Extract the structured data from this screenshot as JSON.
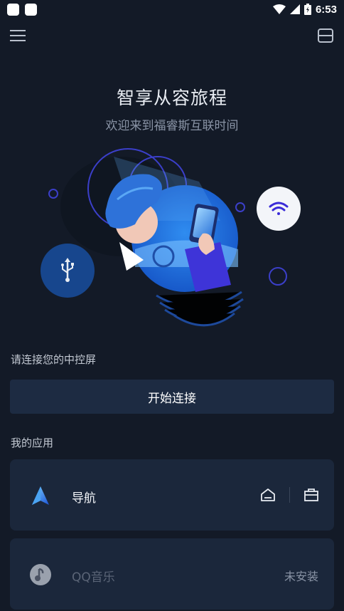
{
  "status_bar": {
    "time": "6:53"
  },
  "hero": {
    "title": "智享从容旅程",
    "subtitle": "欢迎来到福睿斯互联时间"
  },
  "connect": {
    "label": "请连接您的中控屏",
    "button": "开始连接"
  },
  "apps": {
    "label": "我的应用",
    "items": [
      {
        "name": "导航",
        "icon": "navigation-arrow-icon",
        "actions": [
          "home-icon",
          "briefcase-icon"
        ]
      },
      {
        "name": "QQ音乐",
        "icon": "qq-music-icon",
        "status": "未安装"
      }
    ]
  },
  "icons": {
    "menu": "menu-icon",
    "device": "device-icon",
    "usb": "usb-icon",
    "wifi": "wifi-icon"
  },
  "colors": {
    "background": "#131a27",
    "card": "#1b273b",
    "button": "#1d2b42",
    "accent_blue": "#2f6fe0",
    "wifi_purple": "#3a2bd8"
  }
}
